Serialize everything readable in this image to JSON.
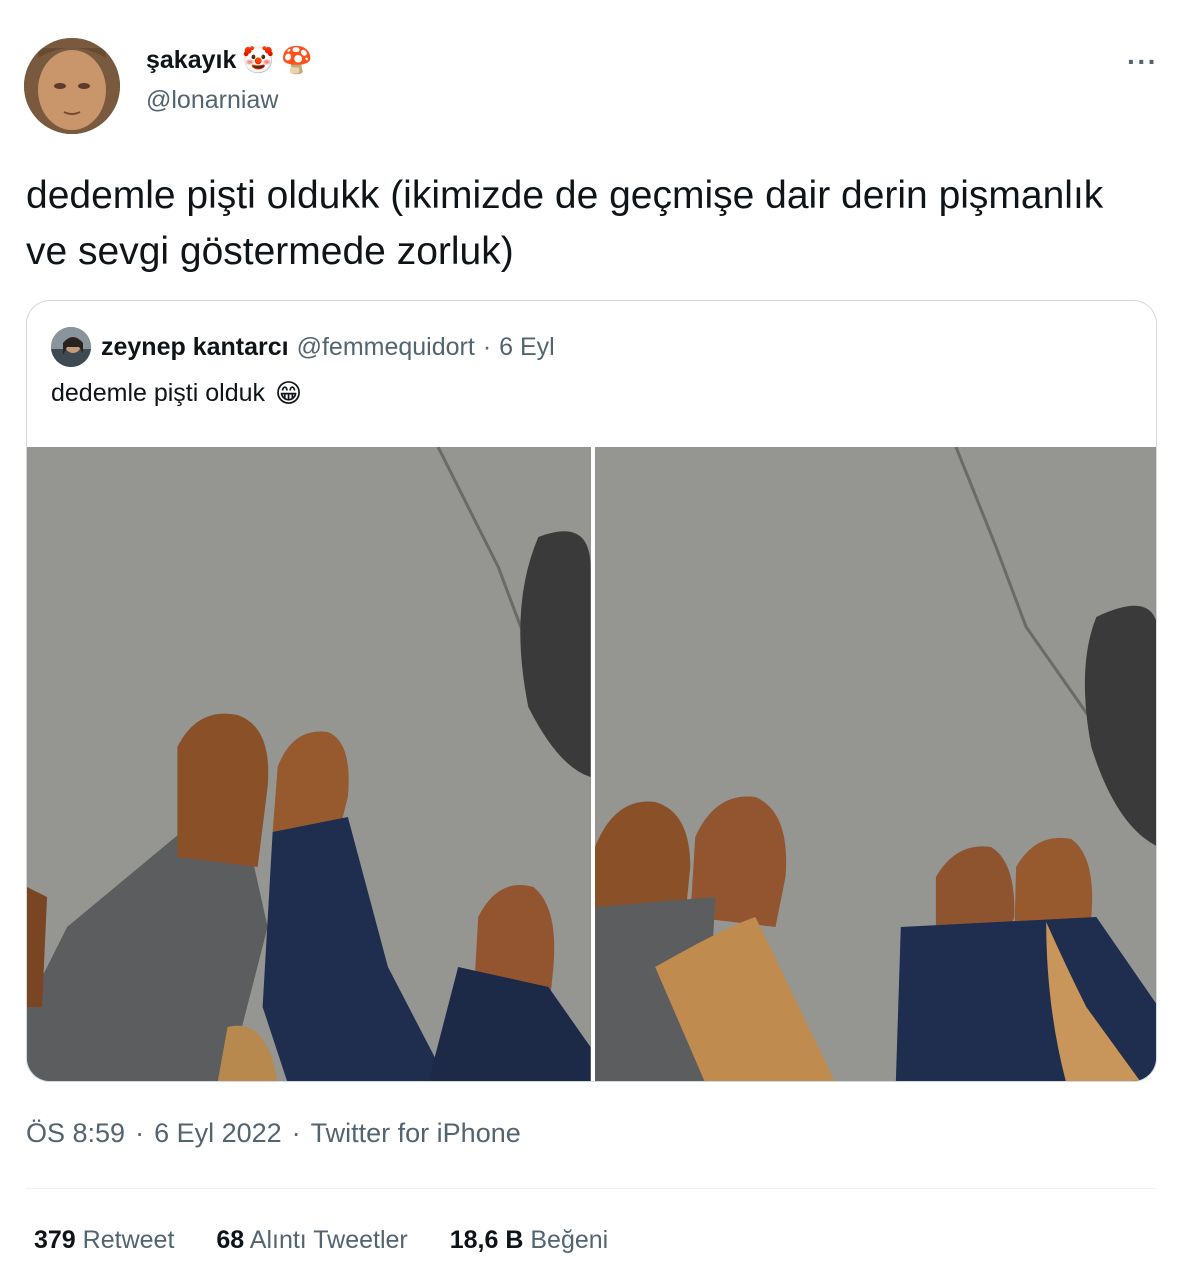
{
  "author": {
    "display_name": "şakayık",
    "emojis": [
      "🤡",
      "🍄"
    ],
    "handle": "@lonarniaw"
  },
  "more_icon": "···",
  "tweet_text": "dedemle pişti oldukk (ikimizde de geçmişe dair derin pişmanlık ve sevgi göstermede zorluk)",
  "quote": {
    "display_name": "zeynep kantarcı",
    "handle": "@femmequidort",
    "separator": "·",
    "date": "6 Eyl",
    "text": "dedemle pişti olduk",
    "emoji": "😁",
    "photos": [
      "shoes-photo-left",
      "shoes-photo-right"
    ]
  },
  "meta": {
    "time": "ÖS 8:59",
    "sep1": "·",
    "date": "6 Eyl 2022",
    "sep2": "·",
    "source": "Twitter for iPhone"
  },
  "stats": [
    {
      "count": "379",
      "label": "Retweet"
    },
    {
      "count": "68",
      "label": "Alıntı Tweetler"
    },
    {
      "count": "18,6 B",
      "label": "Beğeni"
    }
  ],
  "colors": {
    "text_primary": "#0f1419",
    "text_secondary": "#536471",
    "border": "#cfd9de"
  }
}
